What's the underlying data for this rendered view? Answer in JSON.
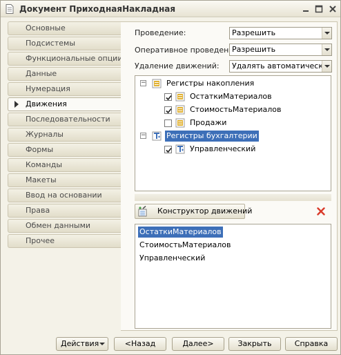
{
  "window": {
    "title": "Документ ПриходнаяНакладная"
  },
  "tabs": [
    {
      "label": "Основные"
    },
    {
      "label": "Подсистемы"
    },
    {
      "label": "Функциональные опции"
    },
    {
      "label": "Данные"
    },
    {
      "label": "Нумерация"
    },
    {
      "label": "Движения",
      "active": true
    },
    {
      "label": "Последовательности"
    },
    {
      "label": "Журналы"
    },
    {
      "label": "Формы"
    },
    {
      "label": "Команды"
    },
    {
      "label": "Макеты"
    },
    {
      "label": "Ввод на основании"
    },
    {
      "label": "Права"
    },
    {
      "label": "Обмен данными"
    },
    {
      "label": "Прочее"
    }
  ],
  "fields": {
    "posting": {
      "label": "Проведение:",
      "value": "Разрешить"
    },
    "realtime_posting": {
      "label": "Оперативное проведение:",
      "value": "Разрешить"
    },
    "delete_movements": {
      "label": "Удаление движений:",
      "value": "Удалять автоматически при"
    }
  },
  "tree": {
    "accumulation": {
      "label": "Регистры накопления",
      "expander": "−",
      "items": [
        {
          "label": "ОстаткиМатериалов",
          "checked": true
        },
        {
          "label": "СтоимостьМатериалов",
          "checked": true
        },
        {
          "label": "Продажи",
          "checked": false
        }
      ]
    },
    "accounting": {
      "label": "Регистры бухгалтерии",
      "expander": "−",
      "selected": true,
      "items": [
        {
          "label": "Управленческий",
          "checked": true
        }
      ]
    }
  },
  "constructor_button": {
    "label": "Конструктор движений"
  },
  "movements_list": [
    {
      "label": "ОстаткиМатериалов",
      "selected": true
    },
    {
      "label": "СтоимостьМатериалов"
    },
    {
      "label": "Управленческий"
    }
  ],
  "footer": {
    "actions": "Действия",
    "back": "<Назад",
    "next": "Далее>",
    "close": "Закрыть",
    "help": "Справка"
  },
  "colors": {
    "selection": "#3d6fb8",
    "delete_icon": "#d93a2a",
    "register_icon": "#e0b030"
  }
}
